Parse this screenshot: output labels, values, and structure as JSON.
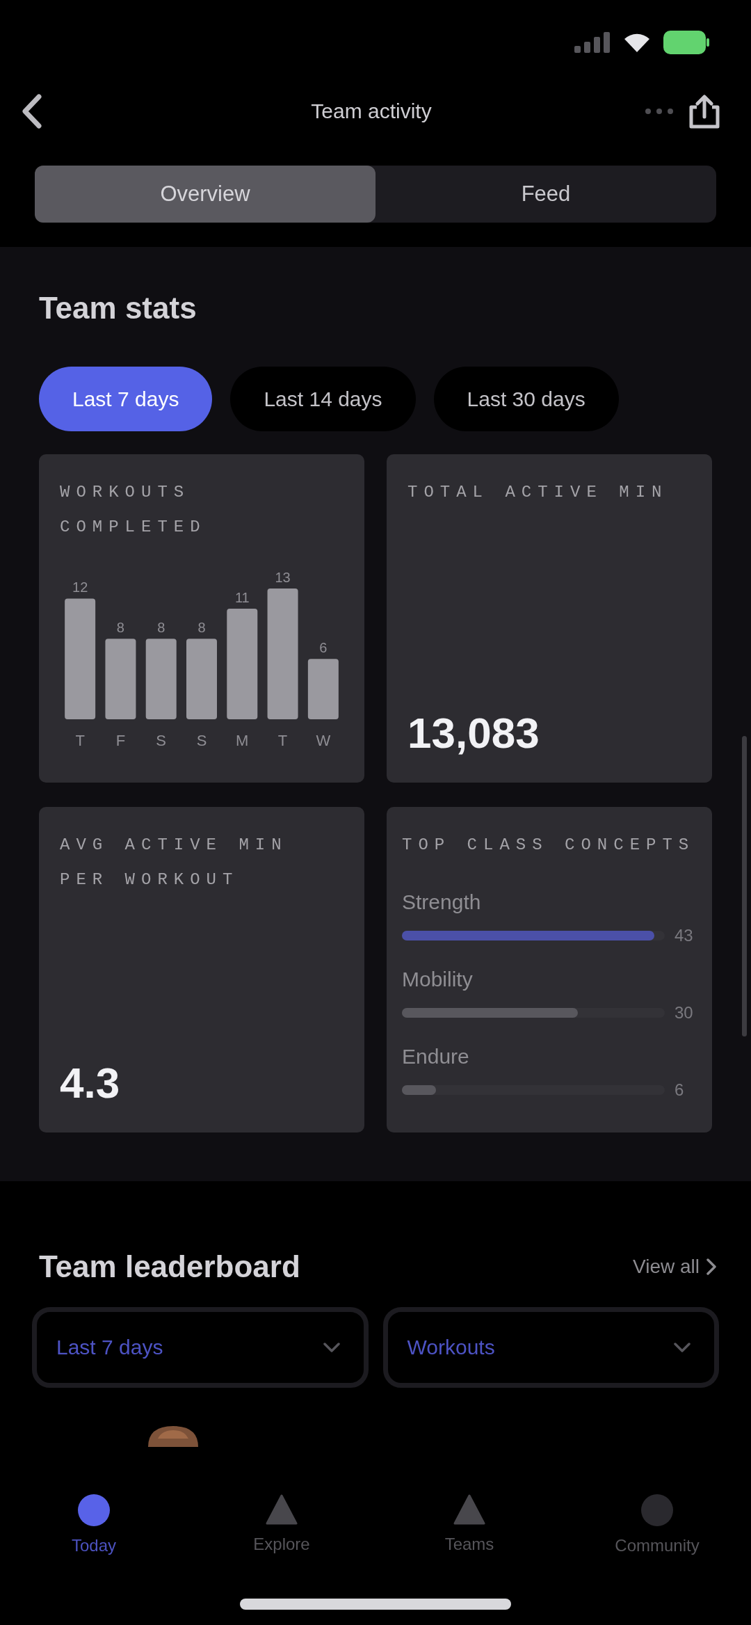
{
  "header": {
    "title": "Team activity"
  },
  "tabs": [
    {
      "label": "Overview",
      "selected": true
    },
    {
      "label": "Feed",
      "selected": false
    }
  ],
  "team_stats": {
    "title": "Team stats",
    "ranges": [
      {
        "label": "Last 7 days",
        "selected": true
      },
      {
        "label": "Last 14 days",
        "selected": false
      },
      {
        "label": "Last 30 days",
        "selected": false
      }
    ],
    "cards": [
      {
        "kind": "chart",
        "label": "WORKOUTS COMPLETED",
        "chart_data": {
          "type": "bar",
          "categories": [
            "T",
            "F",
            "S",
            "S",
            "M",
            "T",
            "W"
          ],
          "values": [
            12,
            8,
            8,
            8,
            11,
            13,
            6
          ],
          "data_labels": true
        }
      },
      {
        "kind": "number",
        "label": "TOTAL ACTIVE MIN",
        "value": "13,083"
      },
      {
        "kind": "number",
        "label": "AVG ACTIVE MIN PER WORKOUT",
        "value": "4.3"
      },
      {
        "kind": "concepts",
        "label": "TOP CLASS CONCEPTS",
        "concepts": [
          {
            "name": "Strength",
            "level": 0.96,
            "value": "43",
            "color": "#4b50a8"
          },
          {
            "name": "Mobility",
            "level": 0.67,
            "value": "30",
            "color": "#58575d"
          },
          {
            "name": "Endure",
            "level": 0.13,
            "value": "6",
            "color": "#58575d"
          }
        ]
      }
    ]
  },
  "leaderboard": {
    "title": "Team leaderboard",
    "link": "View all",
    "filters": [
      {
        "value": "Last 7 days"
      },
      {
        "value": "Workouts"
      }
    ]
  },
  "bottom_nav": [
    {
      "label": "Today",
      "selected": true
    },
    {
      "label": "Explore",
      "selected": false
    },
    {
      "label": "Teams",
      "selected": false
    },
    {
      "label": "Community",
      "selected": false
    }
  ]
}
